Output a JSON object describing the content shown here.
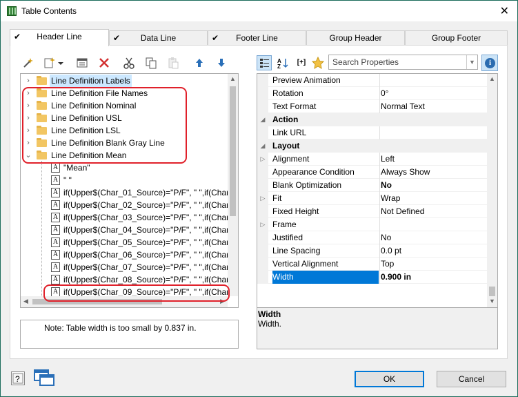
{
  "window": {
    "title": "Table Contents",
    "close_glyph": "✕"
  },
  "tabs": [
    {
      "label": "Header Line",
      "checked": true,
      "active": true
    },
    {
      "label": "Data Line",
      "checked": true,
      "active": false
    },
    {
      "label": "Footer Line",
      "checked": true,
      "active": false
    },
    {
      "label": "Group Header",
      "checked": false,
      "active": false
    },
    {
      "label": "Group Footer",
      "checked": false,
      "active": false
    }
  ],
  "tree_toolbar": [
    "magic-wand-icon",
    "new-item-icon",
    "properties-icon",
    "delete-icon",
    "cut-icon",
    "copy-icon",
    "paste-icon",
    "move-up-icon",
    "move-down-icon"
  ],
  "tree": {
    "folders": [
      "Line Definition Labels",
      "Line Definition File Names",
      "Line Definition Nominal",
      "Line Definition USL",
      "Line Definition LSL",
      "Line Definition Blank Gray Line",
      "Line Definition Mean"
    ],
    "children": [
      "\"Mean\"",
      "\" \"",
      "if(Upper$(Char_01_Source)=\"P/F\", \" \",if(Char",
      "if(Upper$(Char_02_Source)=\"P/F\", \" \",if(Char",
      "if(Upper$(Char_03_Source)=\"P/F\", \" \",if(Char",
      "if(Upper$(Char_04_Source)=\"P/F\", \" \",if(Char",
      "if(Upper$(Char_05_Source)=\"P/F\", \" \",if(Char",
      "if(Upper$(Char_06_Source)=\"P/F\", \" \",if(Char",
      "if(Upper$(Char_07_Source)=\"P/F\", \" \",if(Char",
      "if(Upper$(Char_08_Source)=\"P/F\", \" \",if(Char",
      "if(Upper$(Char_09_Source)=\"P/F\", \" \",if(Char"
    ],
    "child_icon_letter": "A"
  },
  "note": "Note: Table width is too small by 0.837 in.",
  "properties": {
    "search_placeholder": "Search Properties",
    "info_glyph": "i",
    "toolbar_labels": {
      "expand": "[+]"
    },
    "rows": [
      {
        "name": "Preview Animation",
        "value": "",
        "type": "prop",
        "expander": ""
      },
      {
        "name": "Rotation",
        "value": "0°",
        "type": "prop",
        "expander": ""
      },
      {
        "name": "Text Format",
        "value": "Normal Text",
        "type": "prop",
        "expander": ""
      },
      {
        "name": "Action",
        "value": "",
        "type": "cat",
        "expander": "◢"
      },
      {
        "name": "Link URL",
        "value": "",
        "type": "prop",
        "expander": ""
      },
      {
        "name": "Layout",
        "value": "",
        "type": "cat",
        "expander": "◢"
      },
      {
        "name": "Alignment",
        "value": "Left",
        "type": "prop",
        "expander": "▷"
      },
      {
        "name": "Appearance Condition",
        "value": "Always Show",
        "type": "prop",
        "expander": ""
      },
      {
        "name": "Blank Optimization",
        "value": "No",
        "type": "prop",
        "expander": "",
        "bold_value": true
      },
      {
        "name": "Fit",
        "value": "Wrap",
        "type": "prop",
        "expander": "▷"
      },
      {
        "name": "Fixed Height",
        "value": "Not Defined",
        "type": "prop",
        "expander": ""
      },
      {
        "name": "Frame",
        "value": "",
        "type": "prop",
        "expander": "▷"
      },
      {
        "name": "Justified",
        "value": "No",
        "type": "prop",
        "expander": ""
      },
      {
        "name": "Line Spacing",
        "value": "0.0 pt",
        "type": "prop",
        "expander": ""
      },
      {
        "name": "Vertical Alignment",
        "value": "Top",
        "type": "prop",
        "expander": ""
      },
      {
        "name": "Width",
        "value": "0.900 in",
        "type": "prop",
        "expander": "",
        "selected": true,
        "bold_value": true
      }
    ],
    "description": {
      "title": "Width",
      "text": "Width."
    }
  },
  "buttons": {
    "ok": "OK",
    "cancel": "Cancel"
  },
  "colors": {
    "accent": "#0078d7",
    "highlight": "#e0202a"
  }
}
